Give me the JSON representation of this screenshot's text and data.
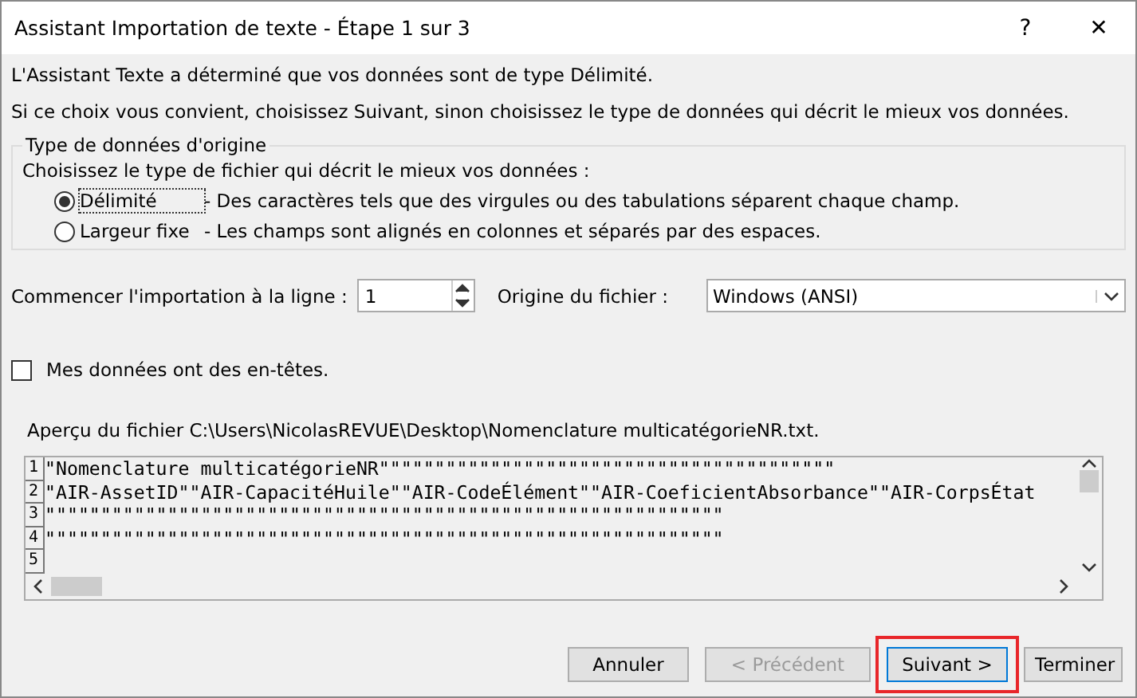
{
  "window": {
    "title": "Assistant Importation de texte - Étape 1 sur 3",
    "help": "?",
    "close": "✕"
  },
  "intro": [
    "L'Assistant Texte a déterminé que vos données sont de type Délimité.",
    "Si ce choix vous convient, choisissez Suivant, sinon choisissez le type de données qui décrit le mieux vos données."
  ],
  "group": {
    "title": "Type de données d'origine",
    "prompt": "Choisissez le type de fichier qui décrit le mieux vos données :",
    "options": [
      {
        "label": "Délimité",
        "description": "- Des caractères tels que des virgules ou des tabulations séparent chaque champ.",
        "selected": true
      },
      {
        "label": "Largeur fixe",
        "description": "- Les champs sont alignés en colonnes et séparés par des espaces.",
        "selected": false
      }
    ]
  },
  "start_row": {
    "label": "Commencer l'importation à la ligne :",
    "value": "1"
  },
  "origin": {
    "label": "Origine du fichier :",
    "value": "Windows (ANSI)"
  },
  "headers": {
    "label": "Mes données ont des en-têtes.",
    "checked": false
  },
  "preview": {
    "label": "Aperçu du fichier C:\\Users\\NicolasREVUE\\Desktop\\Nomenclature multicatégorieNR.txt.",
    "lines": [
      {
        "number": "1",
        "text": "\"Nomenclature multicatégorieNR\"\"\"\"\"\"\"\"\"\"\"\"\"\"\"\"\"\"\"\"\"\"\"\"\"\"\"\"\"\"\"\"\"\"\"\"\"\"\"\"\""
      },
      {
        "number": "2",
        "text": "\"AIR-AssetID\"\"AIR-CapacitéHuile\"\"AIR-CodeÉlément\"\"AIR-CoeficientAbsorbance\"\"AIR-CorpsÉtat"
      },
      {
        "number": "3",
        "text": "\"\"\"\"\"\"\"\"\"\"\"\"\"\"\"\"\"\"\"\"\"\"\"\"\"\"\"\"\"\"\"\"\"\"\"\"\"\"\"\"\"\"\"\"\"\"\"\"\"\"\"\"\"\"\"\"\"\"\"\"\""
      },
      {
        "number": "4",
        "text": "\"\"\"\"\"\"\"\"\"\"\"\"\"\"\"\"\"\"\"\"\"\"\"\"\"\"\"\"\"\"\"\"\"\"\"\"\"\"\"\"\"\"\"\"\"\"\"\"\"\"\"\"\"\"\"\"\"\"\"\"\""
      },
      {
        "number": "5"
      }
    ]
  },
  "buttons": [
    {
      "label": "Annuler",
      "disabled": false,
      "highlighted": false
    },
    {
      "label": "< Précédent",
      "disabled": true,
      "highlighted": false
    },
    {
      "label": "Suivant >",
      "disabled": false,
      "highlighted": true
    },
    {
      "label": "Terminer",
      "disabled": false,
      "highlighted": false
    }
  ]
}
